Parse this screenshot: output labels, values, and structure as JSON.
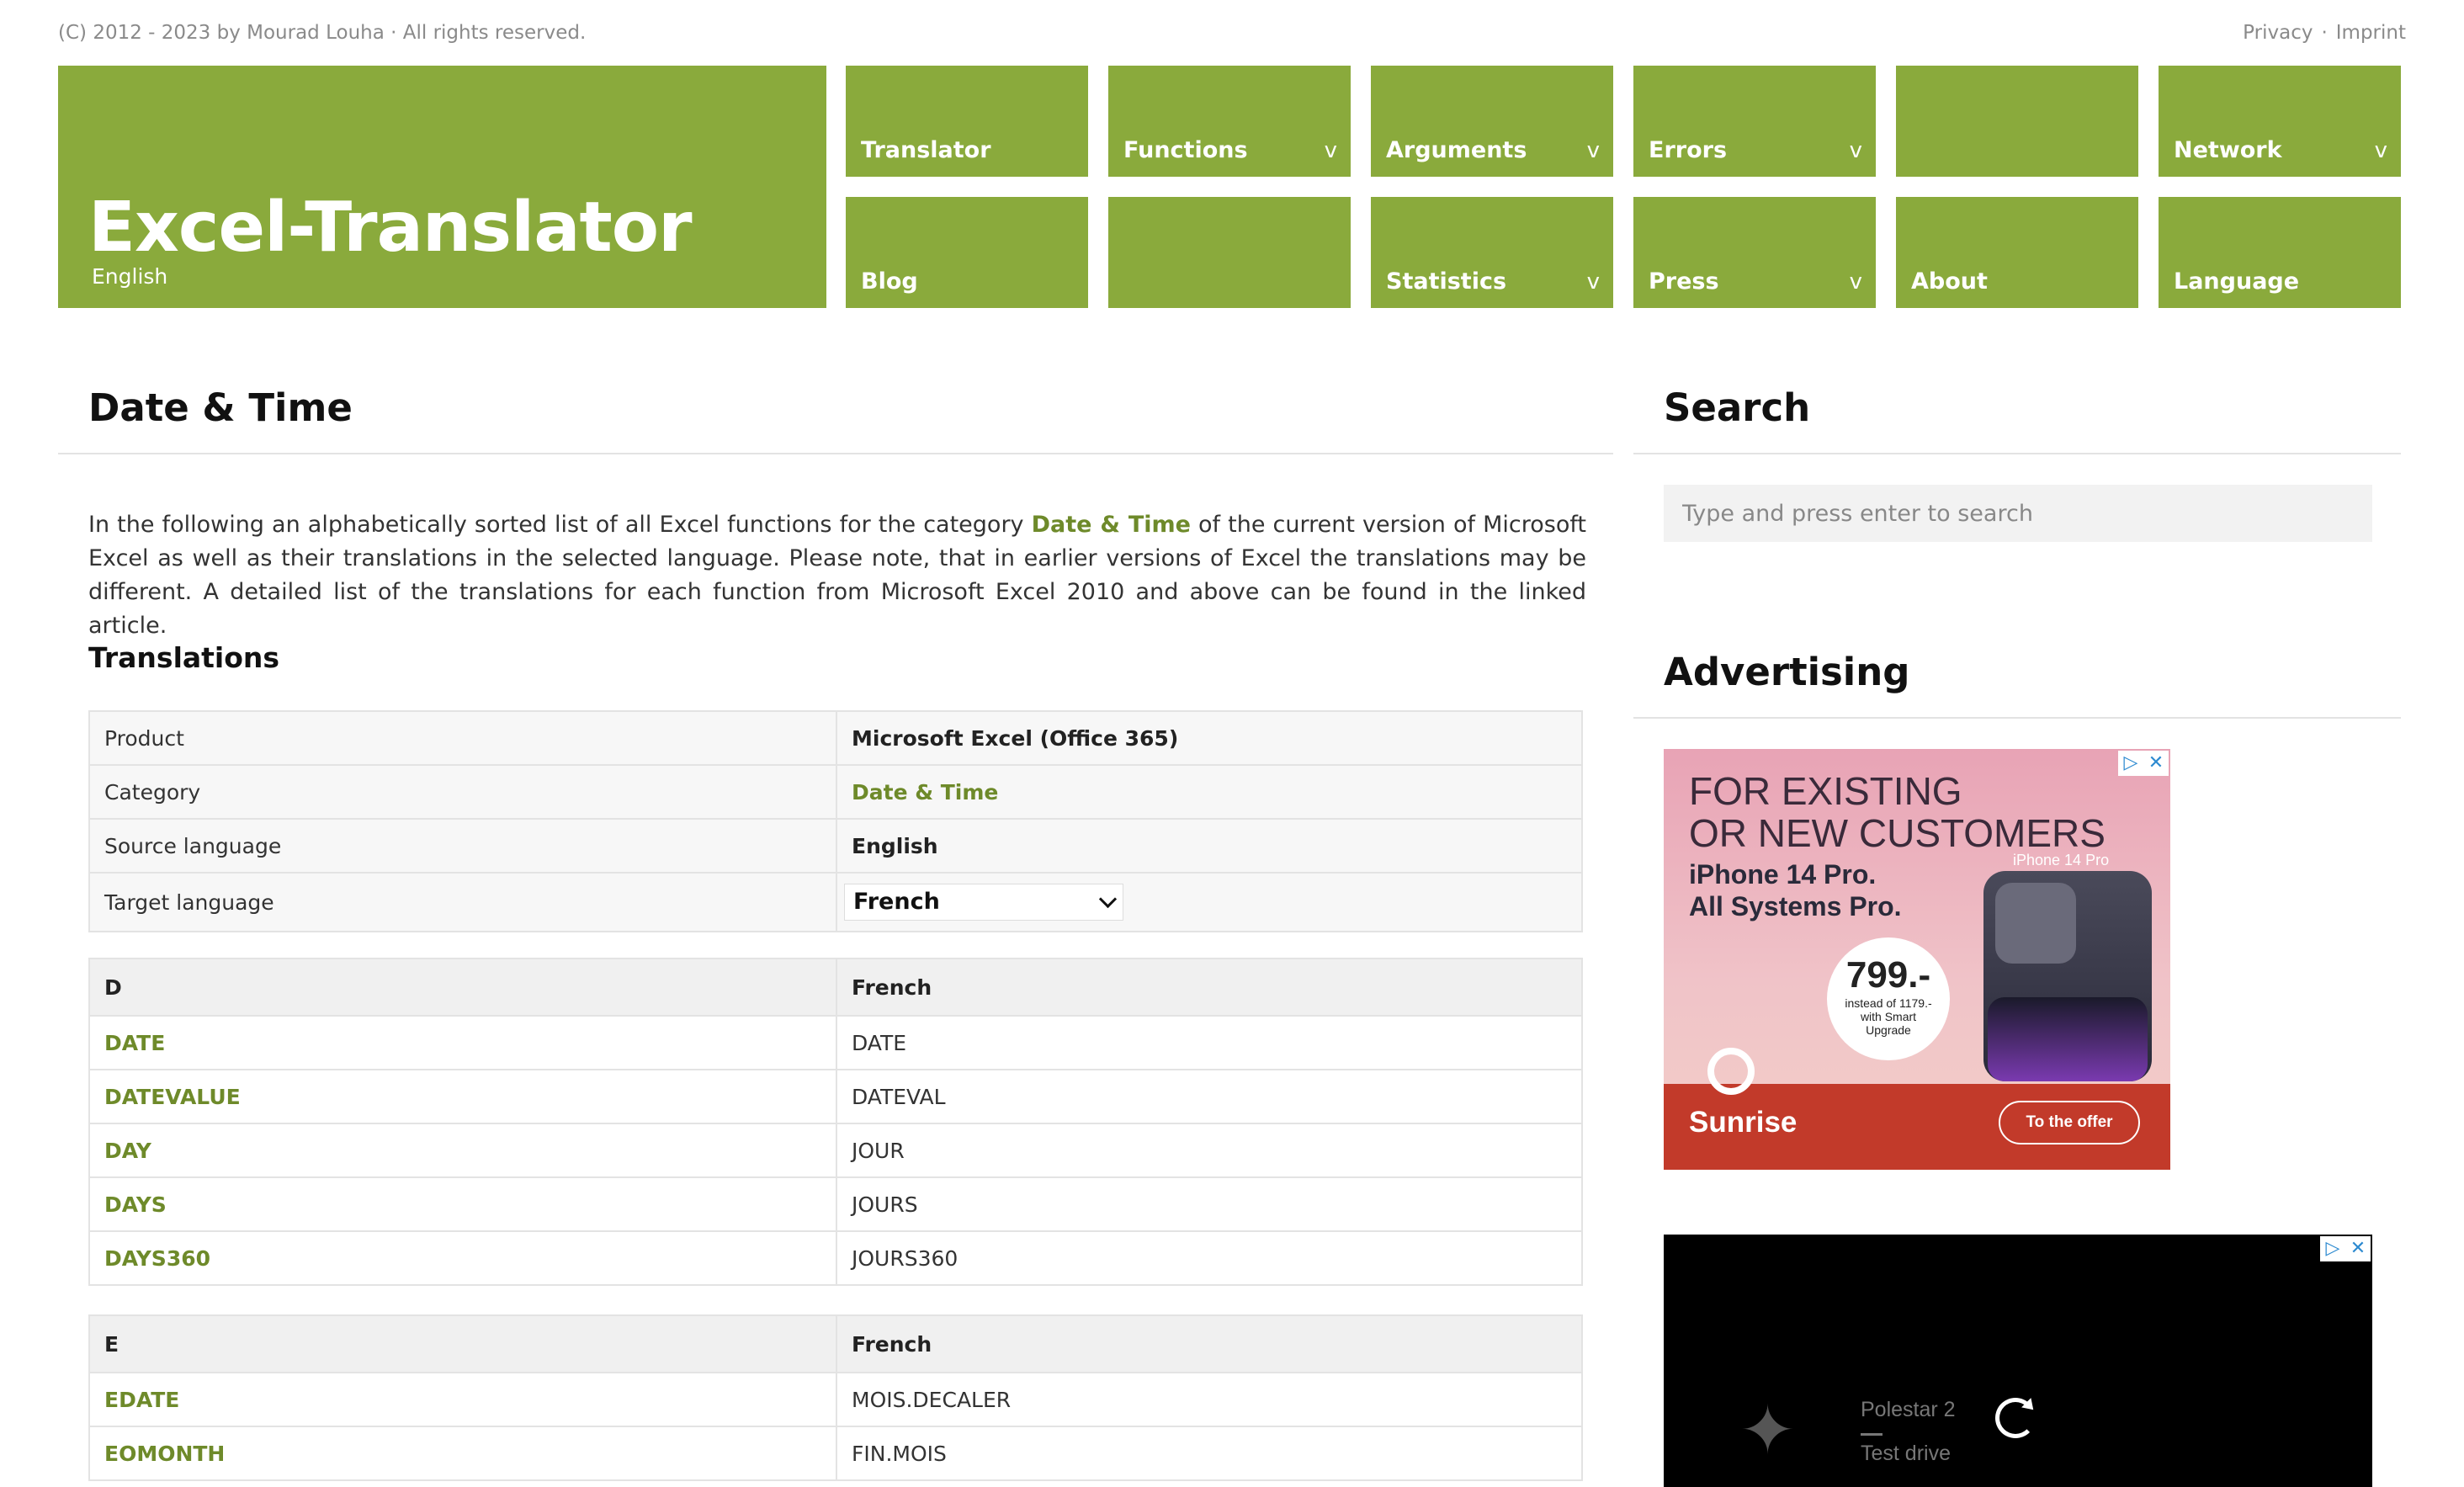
{
  "topbar": {
    "copyright": "(C) 2012 - 2023 by Mourad Louha · All rights reserved.",
    "privacy": "Privacy",
    "separator": "·",
    "imprint": "Imprint"
  },
  "logo": {
    "title": "Excel-Translator",
    "subtitle": "English"
  },
  "nav": {
    "translator": "Translator",
    "functions": "Functions",
    "arguments": "Arguments",
    "errors": "Errors",
    "network": "Network",
    "blog": "Blog",
    "statistics": "Statistics",
    "press": "Press",
    "about": "About",
    "language": "Language",
    "chevron": "v"
  },
  "main": {
    "title": "Date & Time",
    "intro_before": "In the following an alphabetically sorted list of all Excel functions for the category ",
    "intro_highlight": "Date & Time",
    "intro_after": " of the current version of Microsoft Excel as well as their translations in the selected language. Please note, that in earlier versions of Excel the translations may be different. A detailed list of the translations for each function from Microsoft Excel 2010 and above can be found in the linked article.",
    "translations_heading": "Translations",
    "info": {
      "product_label": "Product",
      "product_value": "Microsoft Excel (Office 365)",
      "category_label": "Category",
      "category_value": "Date & Time",
      "source_label": "Source language",
      "source_value": "English",
      "target_label": "Target language",
      "target_value": "French"
    },
    "groups": [
      {
        "letter": "D",
        "lang": "French",
        "rows": [
          {
            "name": "DATE",
            "translation": "DATE"
          },
          {
            "name": "DATEVALUE",
            "translation": "DATEVAL"
          },
          {
            "name": "DAY",
            "translation": "JOUR"
          },
          {
            "name": "DAYS",
            "translation": "JOURS"
          },
          {
            "name": "DAYS360",
            "translation": "JOURS360"
          }
        ]
      },
      {
        "letter": "E",
        "lang": "French",
        "rows": [
          {
            "name": "EDATE",
            "translation": "MOIS.DECALER"
          },
          {
            "name": "EOMONTH",
            "translation": "FIN.MOIS"
          }
        ]
      }
    ]
  },
  "sidebar": {
    "search_title": "Search",
    "search_placeholder": "Type and press enter to search",
    "advertising_title": "Advertising"
  },
  "ad1": {
    "headline_1": "FOR EXISTING",
    "headline_2": "OR NEW CUSTOMERS",
    "line_1": "iPhone 14 Pro.",
    "line_2": "All Systems Pro.",
    "price": "799.-",
    "price_note": "instead of 1179.- with Smart Upgrade",
    "phone_label": "iPhone 14 Pro",
    "brand": "Sunrise",
    "offer": "To the offer"
  },
  "ad2": {
    "line_1": "Polestar 2",
    "line_2": "Test drive"
  },
  "icons": {
    "ad_choices": "▷",
    "ad_close": "✕"
  },
  "colors": {
    "accent": "#8aaa3c",
    "link": "#6e8a2a",
    "ad_red": "#c23a2a"
  }
}
